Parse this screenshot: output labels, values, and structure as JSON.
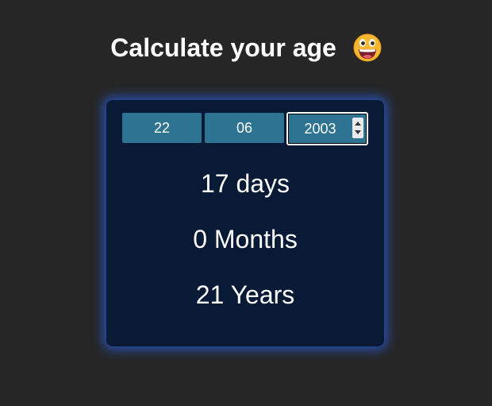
{
  "header": {
    "title": "Calculate your age",
    "emoji_icon": "grinning-face-emoji"
  },
  "form": {
    "day_value": "22",
    "month_value": "06",
    "year_value": "2003"
  },
  "results": {
    "days": "17 days",
    "months": "0 Months",
    "years": "21 Years"
  },
  "colors": {
    "background": "#262626",
    "card": "#081a35",
    "card_glow": "#285ad2",
    "input": "#2e7391",
    "text": "#ffffff"
  }
}
